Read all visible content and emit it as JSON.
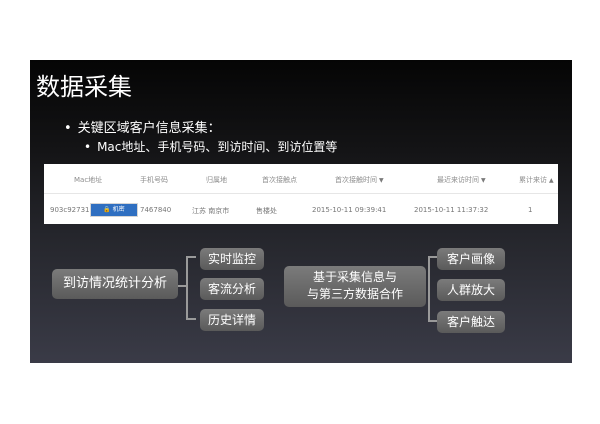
{
  "slide": {
    "title": "数据采集",
    "bullet_marker": "•",
    "bullet1": "关键区域客户信息采集：",
    "bullet2": "Mac地址、手机号码、到访时间、到访位置等"
  },
  "table": {
    "headers": [
      "Mac地址",
      "手机号码",
      "归属地",
      "首次接触点",
      "首次接触时间",
      "最近来访时间",
      "累计来访"
    ],
    "sort_arrows": [
      "▼",
      "▼",
      "▲"
    ],
    "row": {
      "mac": "903c9273196",
      "phone": "7467840",
      "tag": "🔒 机密",
      "location": "江苏 南京市",
      "first_touch": "售楼处",
      "first_time": "2015-10-11 09:39:41",
      "last_time": "2015-10-11 11:37:32",
      "count": "1"
    }
  },
  "diagram": {
    "left": "到访情况统计分析",
    "middle": [
      "实时监控",
      "客流分析",
      "历史详情"
    ],
    "center_line1": "基于采集信息与",
    "center_line2": "与第三方数据合作",
    "right": [
      "客户画像",
      "人群放大",
      "客户触达"
    ]
  }
}
